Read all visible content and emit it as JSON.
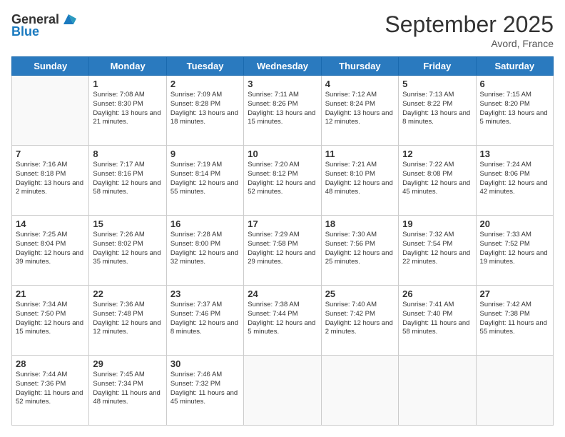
{
  "header": {
    "logo_general": "General",
    "logo_blue": "Blue",
    "title": "September 2025",
    "location": "Avord, France"
  },
  "days": [
    "Sunday",
    "Monday",
    "Tuesday",
    "Wednesday",
    "Thursday",
    "Friday",
    "Saturday"
  ],
  "weeks": [
    [
      {
        "date": "",
        "sunrise": "",
        "sunset": "",
        "daylight": ""
      },
      {
        "date": "1",
        "sunrise": "Sunrise: 7:08 AM",
        "sunset": "Sunset: 8:30 PM",
        "daylight": "Daylight: 13 hours and 21 minutes."
      },
      {
        "date": "2",
        "sunrise": "Sunrise: 7:09 AM",
        "sunset": "Sunset: 8:28 PM",
        "daylight": "Daylight: 13 hours and 18 minutes."
      },
      {
        "date": "3",
        "sunrise": "Sunrise: 7:11 AM",
        "sunset": "Sunset: 8:26 PM",
        "daylight": "Daylight: 13 hours and 15 minutes."
      },
      {
        "date": "4",
        "sunrise": "Sunrise: 7:12 AM",
        "sunset": "Sunset: 8:24 PM",
        "daylight": "Daylight: 13 hours and 12 minutes."
      },
      {
        "date": "5",
        "sunrise": "Sunrise: 7:13 AM",
        "sunset": "Sunset: 8:22 PM",
        "daylight": "Daylight: 13 hours and 8 minutes."
      },
      {
        "date": "6",
        "sunrise": "Sunrise: 7:15 AM",
        "sunset": "Sunset: 8:20 PM",
        "daylight": "Daylight: 13 hours and 5 minutes."
      }
    ],
    [
      {
        "date": "7",
        "sunrise": "Sunrise: 7:16 AM",
        "sunset": "Sunset: 8:18 PM",
        "daylight": "Daylight: 13 hours and 2 minutes."
      },
      {
        "date": "8",
        "sunrise": "Sunrise: 7:17 AM",
        "sunset": "Sunset: 8:16 PM",
        "daylight": "Daylight: 12 hours and 58 minutes."
      },
      {
        "date": "9",
        "sunrise": "Sunrise: 7:19 AM",
        "sunset": "Sunset: 8:14 PM",
        "daylight": "Daylight: 12 hours and 55 minutes."
      },
      {
        "date": "10",
        "sunrise": "Sunrise: 7:20 AM",
        "sunset": "Sunset: 8:12 PM",
        "daylight": "Daylight: 12 hours and 52 minutes."
      },
      {
        "date": "11",
        "sunrise": "Sunrise: 7:21 AM",
        "sunset": "Sunset: 8:10 PM",
        "daylight": "Daylight: 12 hours and 48 minutes."
      },
      {
        "date": "12",
        "sunrise": "Sunrise: 7:22 AM",
        "sunset": "Sunset: 8:08 PM",
        "daylight": "Daylight: 12 hours and 45 minutes."
      },
      {
        "date": "13",
        "sunrise": "Sunrise: 7:24 AM",
        "sunset": "Sunset: 8:06 PM",
        "daylight": "Daylight: 12 hours and 42 minutes."
      }
    ],
    [
      {
        "date": "14",
        "sunrise": "Sunrise: 7:25 AM",
        "sunset": "Sunset: 8:04 PM",
        "daylight": "Daylight: 12 hours and 39 minutes."
      },
      {
        "date": "15",
        "sunrise": "Sunrise: 7:26 AM",
        "sunset": "Sunset: 8:02 PM",
        "daylight": "Daylight: 12 hours and 35 minutes."
      },
      {
        "date": "16",
        "sunrise": "Sunrise: 7:28 AM",
        "sunset": "Sunset: 8:00 PM",
        "daylight": "Daylight: 12 hours and 32 minutes."
      },
      {
        "date": "17",
        "sunrise": "Sunrise: 7:29 AM",
        "sunset": "Sunset: 7:58 PM",
        "daylight": "Daylight: 12 hours and 29 minutes."
      },
      {
        "date": "18",
        "sunrise": "Sunrise: 7:30 AM",
        "sunset": "Sunset: 7:56 PM",
        "daylight": "Daylight: 12 hours and 25 minutes."
      },
      {
        "date": "19",
        "sunrise": "Sunrise: 7:32 AM",
        "sunset": "Sunset: 7:54 PM",
        "daylight": "Daylight: 12 hours and 22 minutes."
      },
      {
        "date": "20",
        "sunrise": "Sunrise: 7:33 AM",
        "sunset": "Sunset: 7:52 PM",
        "daylight": "Daylight: 12 hours and 19 minutes."
      }
    ],
    [
      {
        "date": "21",
        "sunrise": "Sunrise: 7:34 AM",
        "sunset": "Sunset: 7:50 PM",
        "daylight": "Daylight: 12 hours and 15 minutes."
      },
      {
        "date": "22",
        "sunrise": "Sunrise: 7:36 AM",
        "sunset": "Sunset: 7:48 PM",
        "daylight": "Daylight: 12 hours and 12 minutes."
      },
      {
        "date": "23",
        "sunrise": "Sunrise: 7:37 AM",
        "sunset": "Sunset: 7:46 PM",
        "daylight": "Daylight: 12 hours and 8 minutes."
      },
      {
        "date": "24",
        "sunrise": "Sunrise: 7:38 AM",
        "sunset": "Sunset: 7:44 PM",
        "daylight": "Daylight: 12 hours and 5 minutes."
      },
      {
        "date": "25",
        "sunrise": "Sunrise: 7:40 AM",
        "sunset": "Sunset: 7:42 PM",
        "daylight": "Daylight: 12 hours and 2 minutes."
      },
      {
        "date": "26",
        "sunrise": "Sunrise: 7:41 AM",
        "sunset": "Sunset: 7:40 PM",
        "daylight": "Daylight: 11 hours and 58 minutes."
      },
      {
        "date": "27",
        "sunrise": "Sunrise: 7:42 AM",
        "sunset": "Sunset: 7:38 PM",
        "daylight": "Daylight: 11 hours and 55 minutes."
      }
    ],
    [
      {
        "date": "28",
        "sunrise": "Sunrise: 7:44 AM",
        "sunset": "Sunset: 7:36 PM",
        "daylight": "Daylight: 11 hours and 52 minutes."
      },
      {
        "date": "29",
        "sunrise": "Sunrise: 7:45 AM",
        "sunset": "Sunset: 7:34 PM",
        "daylight": "Daylight: 11 hours and 48 minutes."
      },
      {
        "date": "30",
        "sunrise": "Sunrise: 7:46 AM",
        "sunset": "Sunset: 7:32 PM",
        "daylight": "Daylight: 11 hours and 45 minutes."
      },
      {
        "date": "",
        "sunrise": "",
        "sunset": "",
        "daylight": ""
      },
      {
        "date": "",
        "sunrise": "",
        "sunset": "",
        "daylight": ""
      },
      {
        "date": "",
        "sunrise": "",
        "sunset": "",
        "daylight": ""
      },
      {
        "date": "",
        "sunrise": "",
        "sunset": "",
        "daylight": ""
      }
    ]
  ]
}
